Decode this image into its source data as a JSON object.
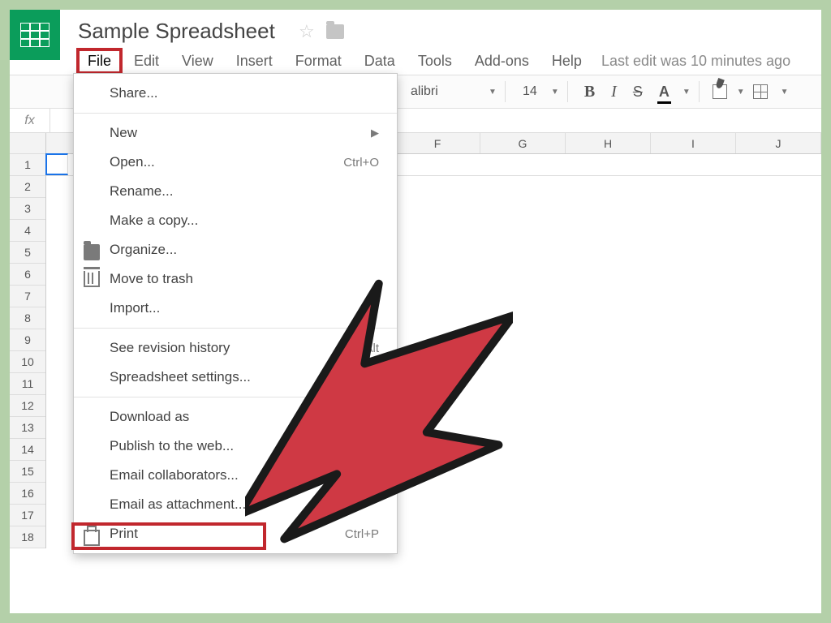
{
  "doc": {
    "title": "Sample Spreadsheet"
  },
  "menubar": {
    "file": "File",
    "edit": "Edit",
    "view": "View",
    "insert": "Insert",
    "format": "Format",
    "data": "Data",
    "tools": "Tools",
    "addons": "Add-ons",
    "help": "Help",
    "last_edit": "Last edit was 10 minutes ago"
  },
  "toolbar": {
    "font": "alibri",
    "size": "14",
    "bold": "B",
    "italic": "I",
    "strike": "S",
    "textcolor": "A"
  },
  "fx": {
    "label": "fx"
  },
  "columns": [
    "F",
    "G",
    "H",
    "I",
    "J"
  ],
  "rows": [
    "1",
    "2",
    "3",
    "4",
    "5",
    "6",
    "7",
    "8",
    "9",
    "10",
    "11",
    "12",
    "13",
    "14",
    "15",
    "16",
    "17",
    "18"
  ],
  "menu": {
    "share": "Share...",
    "new": "New",
    "open": "Open...",
    "open_sc": "Ctrl+O",
    "rename": "Rename...",
    "make_copy": "Make a copy...",
    "organize": "Organize...",
    "trash": "Move to trash",
    "import": "Import...",
    "revision": "See revision history",
    "revision_sc": "Ctrl+Alt",
    "settings": "Spreadsheet settings...",
    "download": "Download as",
    "publish": "Publish to the web...",
    "email_collab": "Email collaborators...",
    "email_attach": "Email as attachment...",
    "print": "Print",
    "print_sc": "Ctrl+P"
  }
}
